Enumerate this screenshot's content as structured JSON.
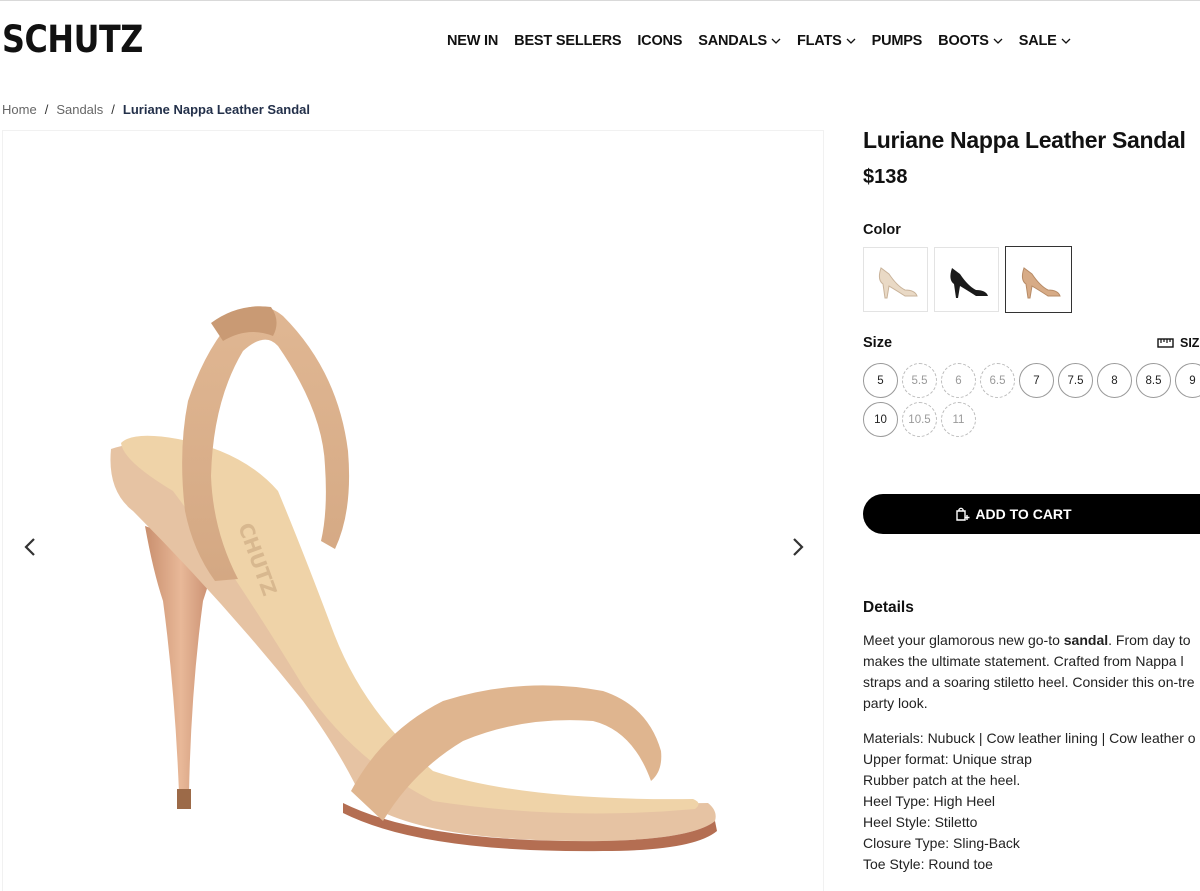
{
  "brand": {
    "logo": "SCHUTZ"
  },
  "nav": {
    "items": [
      {
        "label": "NEW IN",
        "dropdown": false
      },
      {
        "label": "BEST SELLERS",
        "dropdown": false
      },
      {
        "label": "ICONS",
        "dropdown": false
      },
      {
        "label": "SANDALS",
        "dropdown": true
      },
      {
        "label": "FLATS",
        "dropdown": true
      },
      {
        "label": "PUMPS",
        "dropdown": false
      },
      {
        "label": "BOOTS",
        "dropdown": true
      },
      {
        "label": "SALE",
        "dropdown": true
      }
    ]
  },
  "breadcrumb": {
    "home": "Home",
    "category": "Sandals",
    "current": "Luriane Nappa Leather Sandal",
    "separator": "/"
  },
  "product": {
    "title": "Luriane Nappa Leather Sandal",
    "price": "$138",
    "color_label": "Color",
    "colors": [
      {
        "name": "light-neutral",
        "hex": "#e9d9c5",
        "selected": false
      },
      {
        "name": "black",
        "hex": "#1a1a1a",
        "selected": false
      },
      {
        "name": "honey-beige",
        "hex": "#d7ab86",
        "selected": true
      }
    ],
    "size_label": "Size",
    "size_guide_label": "SIZE GUIDE",
    "sizes": [
      {
        "value": "5",
        "available": true
      },
      {
        "value": "5.5",
        "available": false
      },
      {
        "value": "6",
        "available": false
      },
      {
        "value": "6.5",
        "available": false
      },
      {
        "value": "7",
        "available": true
      },
      {
        "value": "7.5",
        "available": true
      },
      {
        "value": "8",
        "available": true
      },
      {
        "value": "8.5",
        "available": true
      },
      {
        "value": "9",
        "available": true
      },
      {
        "value": "10",
        "available": true
      },
      {
        "value": "10.5",
        "available": false
      },
      {
        "value": "11",
        "available": false
      }
    ],
    "add_to_cart": "ADD TO CART",
    "details_title": "Details",
    "description": {
      "line1_pre": "Meet your glamorous new go-to ",
      "line1_bold": "sandal",
      "line1_post": ". From day to",
      "line2": "makes the ultimate statement. Crafted from Nappa l",
      "line3": "straps and a soaring stiletto heel. Consider this on-tre",
      "line4": "party look."
    },
    "specs": [
      "Materials: Nubuck | Cow leather lining | Cow leather o",
      "Upper format: Unique strap",
      "Rubber patch at the heel.",
      "Heel Type: High Heel",
      "Heel Style: Stiletto",
      "Closure Type: Sling-Back",
      "Toe Style: Round toe"
    ]
  },
  "colors": {
    "text": "#111111",
    "button_bg": "#000000",
    "button_text": "#ffffff",
    "breadcrumb_current": "#23304a",
    "shoe": "#d9ad88"
  }
}
